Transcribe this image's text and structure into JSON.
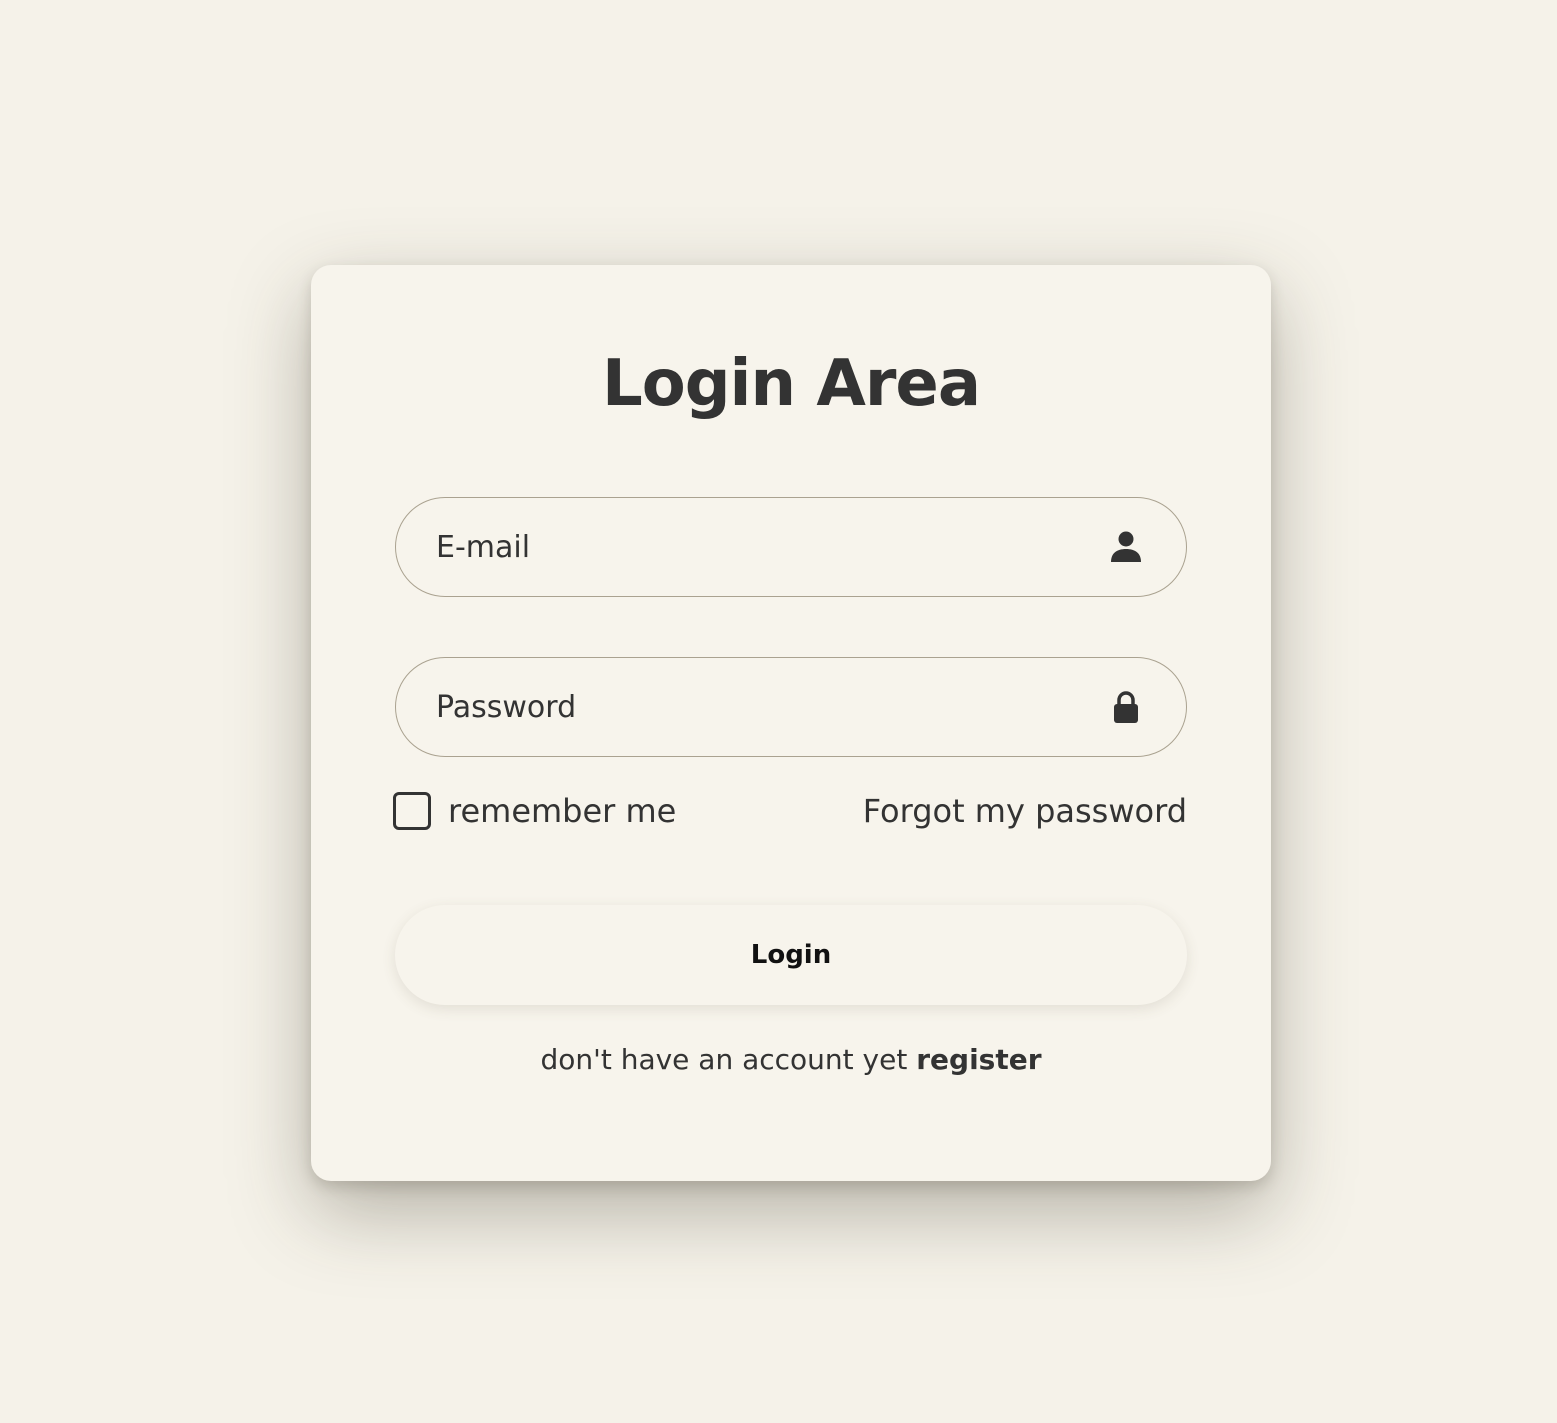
{
  "page": {
    "background_color": "#f5f2e9",
    "card_color": "#f7f4ec",
    "text_color": "#333333"
  },
  "login": {
    "title": "Login Area",
    "email": {
      "placeholder": "E-mail",
      "value": "",
      "icon": "user-icon"
    },
    "password": {
      "placeholder": "Password",
      "value": "",
      "icon": "lock-icon"
    },
    "remember_label": "remember me",
    "remember_checked": false,
    "forgot_label": "Forgot my password",
    "submit_label": "Login",
    "register_prompt": "don't have an account yet",
    "register_link": "register"
  }
}
